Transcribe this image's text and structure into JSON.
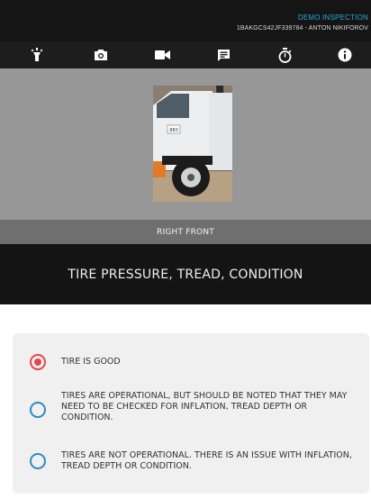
{
  "header": {
    "demo_label": "DEMO INSPECTION",
    "vehicle_line": "1BAKGCS42JF339784 - ANTON NIKIFOROV"
  },
  "toolbar": {
    "icons": [
      "flashlight-icon",
      "camera-icon",
      "video-icon",
      "note-icon",
      "stopwatch-icon",
      "info-icon"
    ],
    "icon_color": "#ffffff"
  },
  "photo": {
    "caption": "RIGHT FRONT",
    "plate_text": "880"
  },
  "inspection_item": {
    "title": "TIRE PRESSURE, TREAD, CONDITION"
  },
  "options": [
    {
      "label": "TIRE IS GOOD",
      "selected": true
    },
    {
      "label": "TIRES ARE OPERATIONAL, BUT SHOULD BE NOTED THAT THEY MAY NEED TO BE CHECKED FOR INFLATION, TREAD DEPTH OR CONDITION.",
      "selected": false
    },
    {
      "label": "TIRES ARE NOT OPERATIONAL.  THERE IS AN ISSUE WITH INFLATION, TREAD DEPTH OR CONDITION.",
      "selected": false
    }
  ],
  "colors": {
    "accent_blue": "#27a9e1",
    "selected_red": "#e5464f",
    "radio_blue": "#2a8dbd"
  }
}
